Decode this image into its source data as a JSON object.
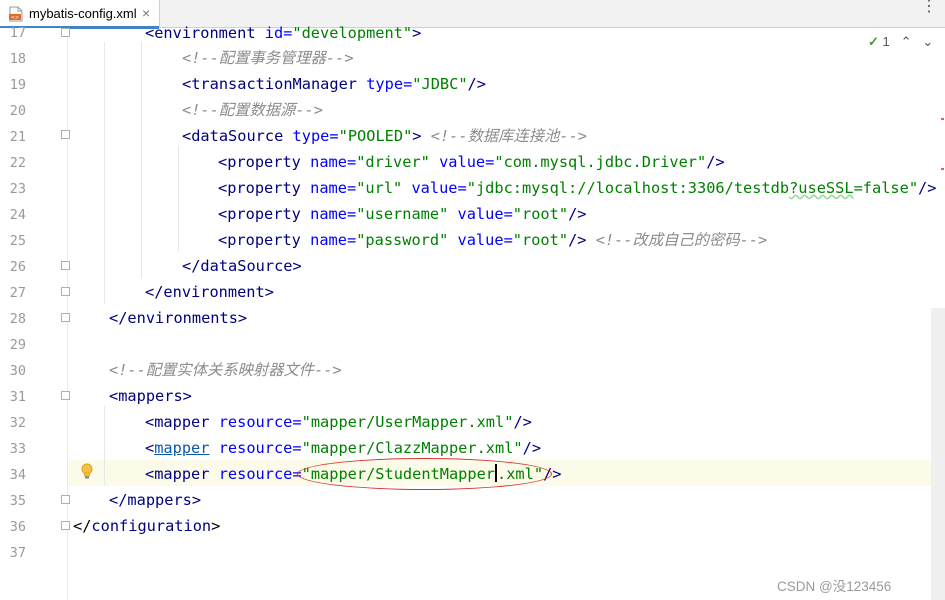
{
  "tab": {
    "file_name": "mybatis-config.xml",
    "close_glyph": "×",
    "icon": "xml-file-icon"
  },
  "menu": {
    "glyph": "⋮"
  },
  "inspection": {
    "check_glyph": "✓",
    "count": "1",
    "up_glyph": "⌃",
    "down_glyph": "⌄"
  },
  "editor": {
    "line_numbers": [
      "17",
      "18",
      "19",
      "20",
      "21",
      "22",
      "23",
      "24",
      "25",
      "26",
      "27",
      "28",
      "29",
      "30",
      "31",
      "32",
      "33",
      "34",
      "35",
      "36",
      "37"
    ],
    "lines": {
      "l17": {
        "open": "<",
        "tag": "environment",
        "attr": "id",
        "eq": "=",
        "val": "\"development\"",
        "close": ">"
      },
      "l18": {
        "comment": "<!--配置事务管理器-->"
      },
      "l19": {
        "open": "<",
        "tag": "transactionManager",
        "attr": "type",
        "eq": "=",
        "val": "\"JDBC\"",
        "close": "/>"
      },
      "l20": {
        "comment": "<!--配置数据源-->"
      },
      "l21": {
        "open": "<",
        "tag": "dataSource",
        "attr": "type",
        "eq": "=",
        "val": "\"POOLED\"",
        "close": ">",
        "comment": "<!--数据库连接池-->"
      },
      "l22": {
        "open": "<",
        "tag": "property",
        "attr1": "name",
        "val1": "\"driver\"",
        "attr2": "value",
        "val2": "\"com.mysql.jdbc.Driver\"",
        "eq": "=",
        "close": "/>"
      },
      "l23": {
        "open": "<",
        "tag": "property",
        "attr1": "name",
        "val1": "\"url\"",
        "attr2": "value",
        "val2a": "\"jdbc:mysql://localhost:3306/testdb",
        "val2b": "?useSSL",
        "val2c": "=false\"",
        "eq": "=",
        "close": "/>"
      },
      "l24": {
        "open": "<",
        "tag": "property",
        "attr1": "name",
        "val1": "\"username\"",
        "attr2": "value",
        "val2": "\"root\"",
        "eq": "=",
        "close": "/>"
      },
      "l25": {
        "open": "<",
        "tag": "property",
        "attr1": "name",
        "val1": "\"password\"",
        "attr2": "value",
        "val2": "\"root\"",
        "eq": "=",
        "close": "/>",
        "comment": "<!--改成自己的密码-->"
      },
      "l26": {
        "text": "</dataSource>"
      },
      "l27": {
        "text": "</environment>"
      },
      "l28": {
        "text": "</environments>"
      },
      "l30": {
        "comment": "<!--配置实体关系映射器文件-->"
      },
      "l31": {
        "text": "<mappers>"
      },
      "l32": {
        "open": "<",
        "tag": "mapper",
        "attr": "resource",
        "eq": "=",
        "val": "\"mapper/UserMapper.xml\"",
        "close": "/>"
      },
      "l33": {
        "open": "<",
        "tag": "mapper",
        "attr": "resource",
        "eq": "=",
        "val": "\"mapper/ClazzMapper.xml\"",
        "close": "/>"
      },
      "l34": {
        "open": "<",
        "tag": "mapper",
        "attr": "resource",
        "eq": "=",
        "val_a": "\"mapper/StudentMapper",
        "val_b": ".xml\"",
        "close": "/>"
      },
      "l35": {
        "text": "</mappers>"
      },
      "l36": {
        "open": "</",
        "tag": "configuration",
        "close": ">"
      }
    }
  },
  "watermark": "CSDN @没123456",
  "colors": {
    "tag": "#000080",
    "attribute": "#0000ff",
    "value": "#008000",
    "comment": "#8c8c8c",
    "highlight_ellipse": "#d9302c",
    "current_line": "#fcfae8"
  }
}
